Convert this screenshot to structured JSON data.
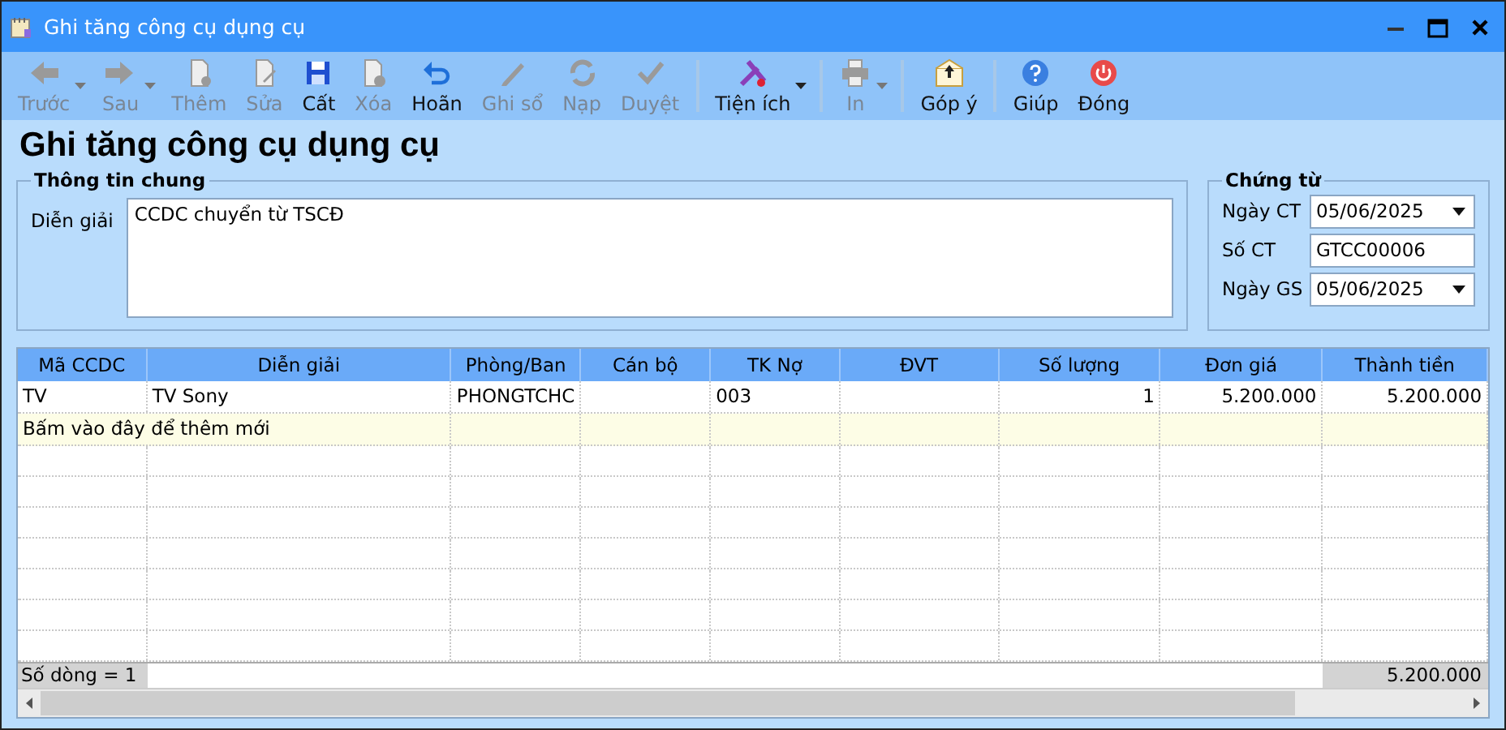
{
  "window": {
    "title": "Ghi tăng công cụ dụng cụ"
  },
  "toolbar": [
    [
      {
        "kind": "back",
        "label": "Trước",
        "disabled": true,
        "dropdown": true
      },
      {
        "kind": "forward",
        "label": "Sau",
        "disabled": true,
        "dropdown": true
      },
      {
        "kind": "new",
        "label": "Thêm",
        "disabled": true,
        "dropdown": false
      },
      {
        "kind": "edit",
        "label": "Sửa",
        "disabled": true,
        "dropdown": false
      },
      {
        "kind": "save",
        "label": "Cất",
        "disabled": false,
        "dropdown": false
      },
      {
        "kind": "delete",
        "label": "Xóa",
        "disabled": true,
        "dropdown": false
      },
      {
        "kind": "undo",
        "label": "Hoãn",
        "disabled": false,
        "dropdown": false
      },
      {
        "kind": "post",
        "label": "Ghi sổ",
        "disabled": true,
        "dropdown": false
      },
      {
        "kind": "reload",
        "label": "Nạp",
        "disabled": true,
        "dropdown": false
      },
      {
        "kind": "approve",
        "label": "Duyệt",
        "disabled": true,
        "dropdown": false
      }
    ],
    [
      {
        "kind": "tools",
        "label": "Tiện ích",
        "disabled": false,
        "dropdown": true
      }
    ],
    [
      {
        "kind": "print",
        "label": "In",
        "disabled": true,
        "dropdown": true
      }
    ],
    [
      {
        "kind": "feedback",
        "label": "Góp ý",
        "disabled": false,
        "dropdown": false
      }
    ],
    [
      {
        "kind": "help",
        "label": "Giúp",
        "disabled": false,
        "dropdown": false
      },
      {
        "kind": "close",
        "label": "Đóng",
        "disabled": false,
        "dropdown": false
      }
    ]
  ],
  "heading": "Ghi tăng công cụ dụng cụ",
  "general": {
    "legend": "Thông tin chung",
    "label": "Diễn giải",
    "value": "CCDC chuyển từ TSCĐ"
  },
  "voucher": {
    "legend": "Chứng từ",
    "fields": [
      {
        "kind": "date",
        "label": "Ngày CT",
        "value": "05/06/2025"
      },
      {
        "kind": "text",
        "label": "Số CT",
        "value": "GTCC00006"
      },
      {
        "kind": "date",
        "label": "Ngày GS",
        "value": "05/06/2025"
      }
    ]
  },
  "table": {
    "columns": [
      {
        "label": "Mã CCDC",
        "kind": "text"
      },
      {
        "label": "Diễn giải",
        "kind": "text"
      },
      {
        "label": "Phòng/Ban",
        "kind": "text"
      },
      {
        "label": "Cán bộ",
        "kind": "text"
      },
      {
        "label": "TK Nợ",
        "kind": "text"
      },
      {
        "label": "ĐVT",
        "kind": "text"
      },
      {
        "label": "Số lượng",
        "kind": "number"
      },
      {
        "label": "Đơn giá",
        "kind": "number"
      },
      {
        "label": "Thành tiền",
        "kind": "number"
      }
    ],
    "rows": [
      [
        "TV",
        "TV Sony",
        "PHONGTCHC",
        "",
        "003",
        "",
        "1",
        "5.200.000",
        "5.200.000"
      ]
    ],
    "add_row": "Bấm vào đây để thêm mới",
    "footer": {
      "count": "Số dòng = 1",
      "total": "5.200.000"
    }
  }
}
